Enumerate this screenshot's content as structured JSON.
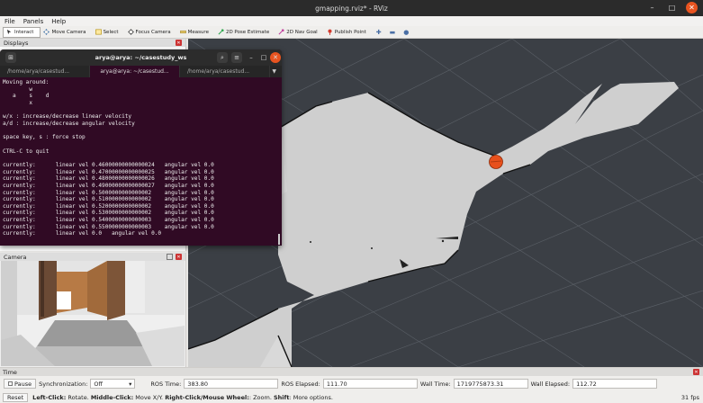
{
  "window": {
    "title": "gmapping.rviz* - RViz"
  },
  "menu": [
    "File",
    "Panels",
    "Help"
  ],
  "toolbar": [
    {
      "label": "Interact",
      "icon": "interact-icon",
      "active": true
    },
    {
      "label": "Move Camera",
      "icon": "move-camera-icon",
      "active": false
    },
    {
      "label": "Select",
      "icon": "select-icon",
      "active": false
    },
    {
      "label": "Focus Camera",
      "icon": "focus-camera-icon",
      "active": false
    },
    {
      "label": "Measure",
      "icon": "measure-icon",
      "active": false
    },
    {
      "label": "2D Pose Estimate",
      "icon": "pose-estimate-icon",
      "active": false
    },
    {
      "label": "2D Nav Goal",
      "icon": "nav-goal-icon",
      "active": false
    },
    {
      "label": "Publish Point",
      "icon": "publish-point-icon",
      "active": false
    }
  ],
  "displays": {
    "title": "Displays"
  },
  "camera": {
    "title": "Camera"
  },
  "terminal": {
    "title": "arya@arya: ~/casestudy_ws",
    "tabs": [
      "/home/arya/casestud...",
      "arya@arya: ~/casestud...",
      "/home/arya/casestud..."
    ],
    "lines": [
      "Moving around:",
      "        w",
      "   a    s    d",
      "        x",
      "",
      "w/x : increase/decrease linear velocity",
      "a/d : increase/decrease angular velocity",
      "",
      "space key, s : force stop",
      "",
      "CTRL-C to quit",
      "",
      "currently:      linear vel 0.46000000000000024   angular vel 0.0",
      "currently:      linear vel 0.47000000000000025   angular vel 0.0",
      "currently:      linear vel 0.48000000000000026   angular vel 0.0",
      "currently:      linear vel 0.49000000000000027   angular vel 0.0",
      "currently:      linear vel 0.5000000000000002    angular vel 0.0",
      "currently:      linear vel 0.5100000000000002    angular vel 0.0",
      "currently:      linear vel 0.5200000000000002    angular vel 0.0",
      "currently:      linear vel 0.5300000000000002    angular vel 0.0",
      "currently:      linear vel 0.5400000000000003    angular vel 0.0",
      "currently:      linear vel 0.5500000000000003    angular vel 0.0",
      "currently:      linear vel 0.0   angular vel 0.0",
      ""
    ]
  },
  "time": {
    "title": "Time",
    "pause_label": "Pause",
    "sync_label": "Synchronization:",
    "sync_value": "Off",
    "ros_time_label": "ROS Time:",
    "ros_time": "383.80",
    "ros_elapsed_label": "ROS Elapsed:",
    "ros_elapsed": "111.70",
    "wall_time_label": "Wall Time:",
    "wall_time": "1719775873.31",
    "wall_elapsed_label": "Wall Elapsed:",
    "wall_elapsed": "112.72"
  },
  "status": {
    "reset_label": "Reset",
    "hint_parts": [
      {
        "text": "Left-Click:",
        "bold": true
      },
      {
        "text": " Rotate. ",
        "bold": false
      },
      {
        "text": "Middle-Click:",
        "bold": true
      },
      {
        "text": " Move X/Y. ",
        "bold": false
      },
      {
        "text": "Right-Click/Mouse Wheel:",
        "bold": true
      },
      {
        "text": ": Zoom. ",
        "bold": false
      },
      {
        "text": "Shift",
        "bold": true
      },
      {
        "text": ": More options.",
        "bold": false
      }
    ],
    "fps": "31 fps"
  },
  "colors": {
    "terminal_bg": "#300a24",
    "map_free": "#cdcdcd",
    "map_unknown": "#3b3f45",
    "robot": "#e8501c",
    "close_button": "#e95420"
  }
}
